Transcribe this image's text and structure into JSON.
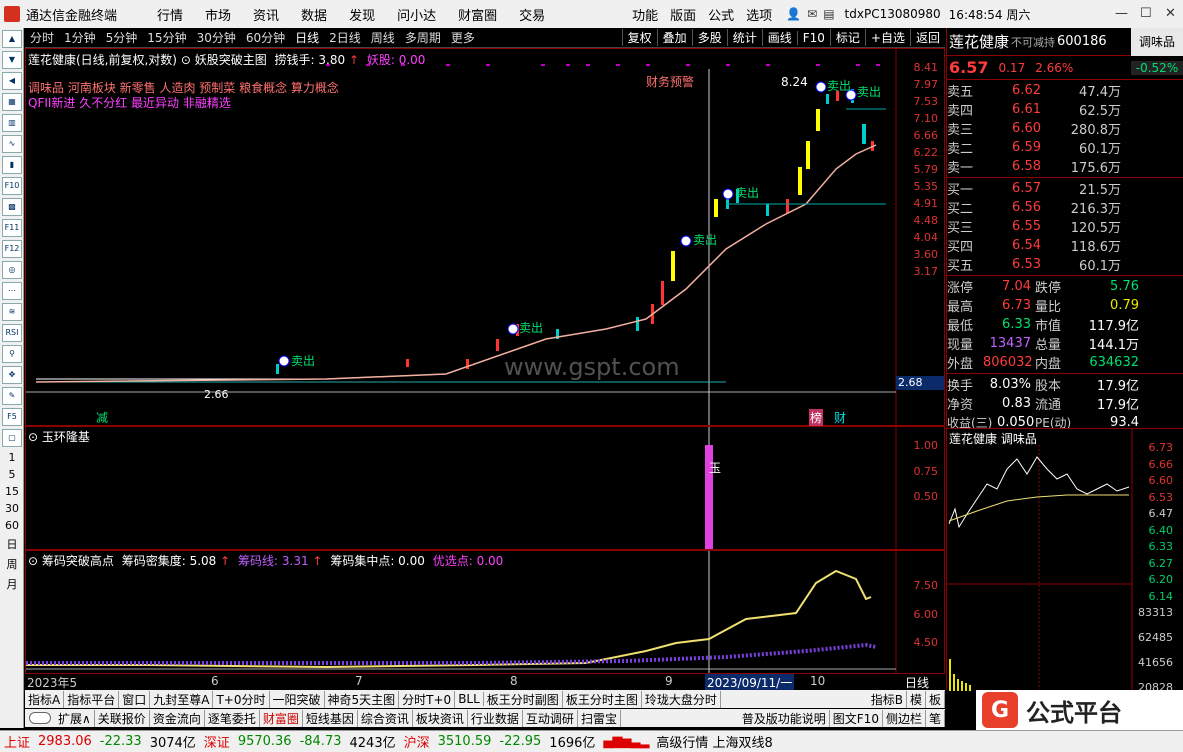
{
  "titlebar": {
    "app_name": "通达信金融终端",
    "menus": [
      "行情",
      "市场",
      "资讯",
      "数据",
      "发现",
      "问小达",
      "财富圈",
      "交易"
    ],
    "right_menus": [
      "功能",
      "版面",
      "公式",
      "选项"
    ],
    "account": "tdxPC13080980",
    "time": "16:48:54 周六"
  },
  "left_toolbar": {
    "periods_text": [
      "1",
      "5",
      "15",
      "30",
      "60",
      "日",
      "周",
      "月"
    ]
  },
  "periodbar": {
    "items": [
      "分时",
      "1分钟",
      "5分钟",
      "15分钟",
      "30分钟",
      "60分钟",
      "日线",
      "2日线",
      "周线",
      "多周期",
      "更多"
    ],
    "right_buttons": [
      "复权",
      "叠加",
      "多股",
      "统计",
      "画线",
      "F10",
      "标记",
      "+自选",
      "返回"
    ]
  },
  "main_chart": {
    "header_name": "莲花健康(日线,前复权,对数)",
    "formula": "妖股突破主图",
    "laoqian": "捞钱手: 3.80",
    "yaogu": "妖股: 0.00",
    "concepts_line1": "调味品 河南板块 新零售 人造肉 预制菜 粮食概念 算力概念",
    "concepts_line2": "QFII新进 久不分红 最近异动 非融精选",
    "annot_finance": "财务预警",
    "annot_high": "8.24",
    "annot_low": "2.66",
    "sell_label": "卖出",
    "jian_label": "减",
    "bang_label": "榜",
    "cai_label": "财",
    "watermark": "www.gspt.com",
    "current_price_tag": "2.68",
    "y_ticks": [
      "8.41",
      "7.97",
      "7.53",
      "7.10",
      "6.66",
      "6.22",
      "5.79",
      "5.35",
      "4.91",
      "4.48",
      "4.04",
      "3.60",
      "3.17"
    ]
  },
  "sub1": {
    "title": "玉环隆基",
    "marker": "玉",
    "y_ticks": [
      "1.00",
      "0.75",
      "0.50"
    ]
  },
  "sub2": {
    "title": "筹码突破高点",
    "density": "筹码密集度: 5.08",
    "line": "筹码线: 3.31",
    "center": "筹码集中点: 0.00",
    "pick": "优选点: 0.00",
    "y_ticks": [
      "7.50",
      "6.00",
      "4.50"
    ]
  },
  "time_axis": {
    "labels": [
      "2023年5",
      "6",
      "7",
      "8",
      "9",
      "2023/09/11/一",
      "10"
    ],
    "period": "日线"
  },
  "quote": {
    "name": "莲花健康",
    "flag": "不可减持",
    "code": "600186",
    "tag": "调味品",
    "price": "6.57",
    "change": "0.17",
    "pct": "2.66%",
    "tag_pct": "-0.52%",
    "asks": [
      {
        "label": "卖五",
        "price": "6.62",
        "vol": "47.4万"
      },
      {
        "label": "卖四",
        "price": "6.61",
        "vol": "62.5万"
      },
      {
        "label": "卖三",
        "price": "6.60",
        "vol": "280.8万"
      },
      {
        "label": "卖二",
        "price": "6.59",
        "vol": "60.1万"
      },
      {
        "label": "卖一",
        "price": "6.58",
        "vol": "175.6万"
      }
    ],
    "bids": [
      {
        "label": "买一",
        "price": "6.57",
        "vol": "21.5万"
      },
      {
        "label": "买二",
        "price": "6.56",
        "vol": "216.3万"
      },
      {
        "label": "买三",
        "price": "6.55",
        "vol": "120.5万"
      },
      {
        "label": "买四",
        "price": "6.54",
        "vol": "118.6万"
      },
      {
        "label": "买五",
        "price": "6.53",
        "vol": "60.1万"
      }
    ],
    "stats": [
      {
        "k1": "涨停",
        "v1": "7.04",
        "k2": "跌停",
        "v2": "5.76"
      },
      {
        "k1": "最高",
        "v1": "6.73",
        "k2": "量比",
        "v2": "0.79"
      },
      {
        "k1": "最低",
        "v1": "6.33",
        "k2": "市值",
        "v2": "117.9亿"
      },
      {
        "k1": "现量",
        "v1": "13437",
        "k2": "总量",
        "v2": "144.1万"
      },
      {
        "k1": "外盘",
        "v1": "806032",
        "k2": "内盘",
        "v2": "634632"
      }
    ],
    "stats2": [
      {
        "k1": "换手",
        "v1": "8.03%",
        "k2": "股本",
        "v2": "17.9亿"
      },
      {
        "k1": "净资",
        "v1": "0.83",
        "k2": "流通",
        "v2": "17.9亿"
      },
      {
        "k1": "收益(三)",
        "v1": "0.050",
        "k2": "PE(动)",
        "v2": "93.4"
      }
    ]
  },
  "mini": {
    "title": "莲花健康 调味品",
    "y_ticks": [
      "6.73",
      "6.66",
      "6.60",
      "6.53",
      "6.47",
      "6.40",
      "6.33",
      "6.27",
      "6.20",
      "6.14"
    ],
    "vol_ticks": [
      "83313",
      "62485",
      "41656",
      "20828"
    ]
  },
  "bottom_tabs_row1": [
    "指标A",
    "指标平台",
    "窗口",
    "九封至尊A",
    "T+0分时",
    "一阳突破",
    "神奇5天主图",
    "分时T+0",
    "BLL",
    "板王分时副图",
    "板王分时主图",
    "玲珑大盘分时",
    "指标B",
    "模",
    "板"
  ],
  "bottom_tabs_row2": [
    "扩展∧",
    "关联报价",
    "资金流向",
    "逐笔委托",
    "财富圈",
    "短线基因",
    "综合资讯",
    "板块资讯",
    "行业数据",
    "互动调研",
    "扫雷宝",
    "普及版功能说明",
    "图文F10",
    "侧边栏",
    "笔"
  ],
  "statusbar": {
    "items": [
      {
        "name": "上证",
        "val": "2983.06",
        "chg": "-22.33",
        "amt": "3074亿"
      },
      {
        "name": "深证",
        "val": "9570.36",
        "chg": "-84.73",
        "amt": "4243亿"
      },
      {
        "name": "沪深",
        "val": "3510.59",
        "chg": "-22.95",
        "amt": "1696亿"
      }
    ],
    "right": "高级行情 上海双线8"
  },
  "brand": {
    "text": "公式平台",
    "site": "www.gspt.com"
  },
  "colors": {
    "up": "#ff3b3b",
    "down": "#00e070",
    "bg": "#000000",
    "grid": "#8b0000"
  }
}
